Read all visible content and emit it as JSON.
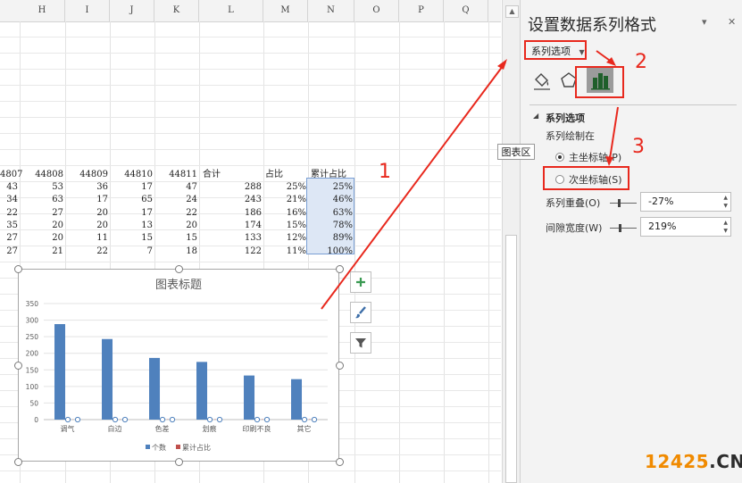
{
  "sheet": {
    "columns": [
      "H",
      "I",
      "J",
      "K",
      "L",
      "M",
      "N",
      "O",
      "P",
      "Q"
    ],
    "header_row": [
      "4807",
      "44808",
      "44809",
      "44810",
      "44811",
      "合计",
      "占比",
      "累计占比"
    ],
    "rows": [
      [
        "43",
        "53",
        "36",
        "17",
        "47",
        "288",
        "25%",
        "25%"
      ],
      [
        "34",
        "63",
        "17",
        "65",
        "24",
        "243",
        "21%",
        "46%"
      ],
      [
        "22",
        "27",
        "20",
        "17",
        "22",
        "186",
        "16%",
        "63%"
      ],
      [
        "35",
        "20",
        "20",
        "13",
        "20",
        "174",
        "15%",
        "78%"
      ],
      [
        "27",
        "20",
        "11",
        "15",
        "15",
        "133",
        "12%",
        "89%"
      ],
      [
        "27",
        "21",
        "22",
        "7",
        "18",
        "122",
        "11%",
        "100%"
      ]
    ]
  },
  "chart_side_buttons": [
    {
      "name": "add-chart-element-button",
      "icon": "plus-icon"
    },
    {
      "name": "chart-styles-button",
      "icon": "paintbrush-icon"
    },
    {
      "name": "chart-filters-button",
      "icon": "funnel-icon"
    }
  ],
  "chart_data": {
    "type": "bar",
    "title": "图表标题",
    "categories": [
      "调气",
      "白边",
      "色差",
      "划痕",
      "印刷不良",
      "其它"
    ],
    "series": [
      {
        "name": "个数",
        "values": [
          288,
          243,
          186,
          174,
          133,
          122
        ],
        "color": "#4f81bd"
      },
      {
        "name": "累计占比",
        "values": [
          0.25,
          0.46,
          0.63,
          0.78,
          0.89,
          1.0
        ],
        "color": "#c0504d"
      }
    ],
    "ylim": [
      0,
      350
    ],
    "yticks": [
      "0",
      "50",
      "100",
      "150",
      "200",
      "250",
      "300",
      "350"
    ],
    "legend_position": "bottom"
  },
  "tooltip": "图表区",
  "panel": {
    "title": "设置数据系列格式",
    "dropdown_label": "系列选项",
    "section_title": "系列选项",
    "plot_on_label": "系列绘制在",
    "primary_axis_label": "主坐标轴(P)",
    "secondary_axis_label": "次坐标轴(S)",
    "overlap_label": "系列重叠(O)",
    "overlap_value": "-27%",
    "gap_label": "间隙宽度(W)",
    "gap_value": "219%"
  },
  "annotations": [
    "1",
    "2",
    "3"
  ],
  "watermark": {
    "part1": "12425",
    "part2": ".CN"
  }
}
